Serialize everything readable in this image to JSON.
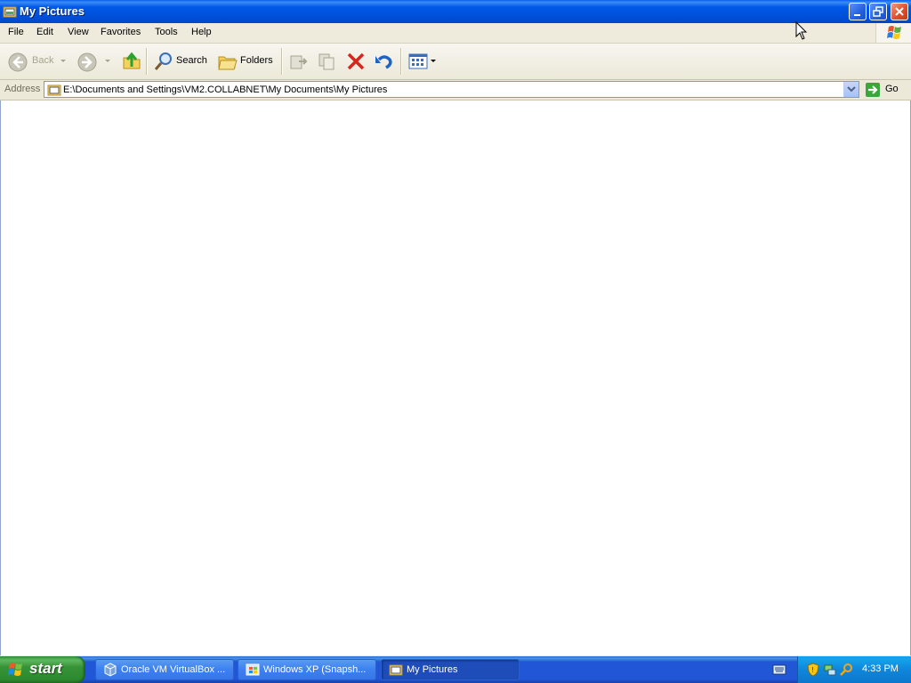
{
  "window": {
    "title": "My Pictures"
  },
  "menu": {
    "items": [
      "File",
      "Edit",
      "View",
      "Favorites",
      "Tools",
      "Help"
    ]
  },
  "toolbar": {
    "back_label": "Back",
    "search_label": "Search",
    "folders_label": "Folders"
  },
  "address": {
    "label": "Address",
    "value": "E:\\Documents and Settings\\VM2.COLLABNET\\My Documents\\My Pictures",
    "go_label": "Go"
  },
  "taskbar": {
    "start_label": "start",
    "tasks": [
      {
        "label": "Oracle VM VirtualBox ...",
        "icon": "virtualbox-icon",
        "active": false
      },
      {
        "label": "Windows XP (Snapsh...",
        "icon": "vm-window-icon",
        "active": false
      },
      {
        "label": "My Pictures",
        "icon": "folder-pictures-icon",
        "active": true
      }
    ],
    "clock": "4:33 PM"
  },
  "colors": {
    "titlebar": "#0058E6",
    "taskbar": "#2157D7",
    "start_button": "#379337",
    "tray": "#0F86DA",
    "close_button": "#E0502C"
  }
}
